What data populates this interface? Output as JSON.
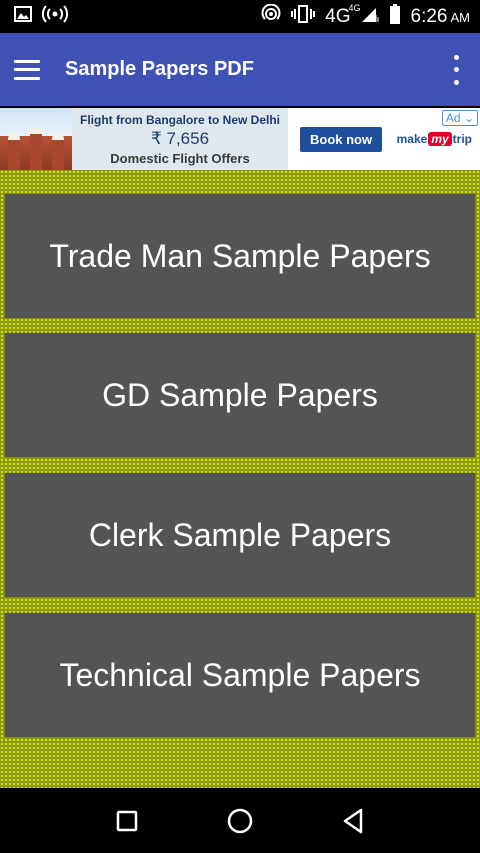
{
  "status_bar": {
    "network": "4G",
    "network_super": "4G",
    "time": "6:26",
    "ampm": "AM",
    "icons": [
      "image-icon",
      "broadcast-icon",
      "hotspot-icon",
      "vibrate-icon",
      "signal-icon",
      "battery-icon"
    ]
  },
  "app_bar": {
    "title": "Sample Papers PDF",
    "color": "#3f51b5"
  },
  "ad": {
    "line1": "Flight from Bangalore to New Delhi",
    "price": "₹ 7,656",
    "line3": "Domestic Flight Offers",
    "cta": "Book now",
    "brand_make": "make",
    "brand_my": "my",
    "brand_trip": "trip",
    "badge": "Ad"
  },
  "papers": [
    {
      "label": "Trade Man Sample Papers"
    },
    {
      "label": "GD Sample Papers"
    },
    {
      "label": "Clerk Sample Papers"
    },
    {
      "label": "Technical Sample Papers"
    }
  ],
  "colors": {
    "button_bg": "#545454",
    "content_bg": "#8a9c11",
    "dot": "#dfe300"
  }
}
